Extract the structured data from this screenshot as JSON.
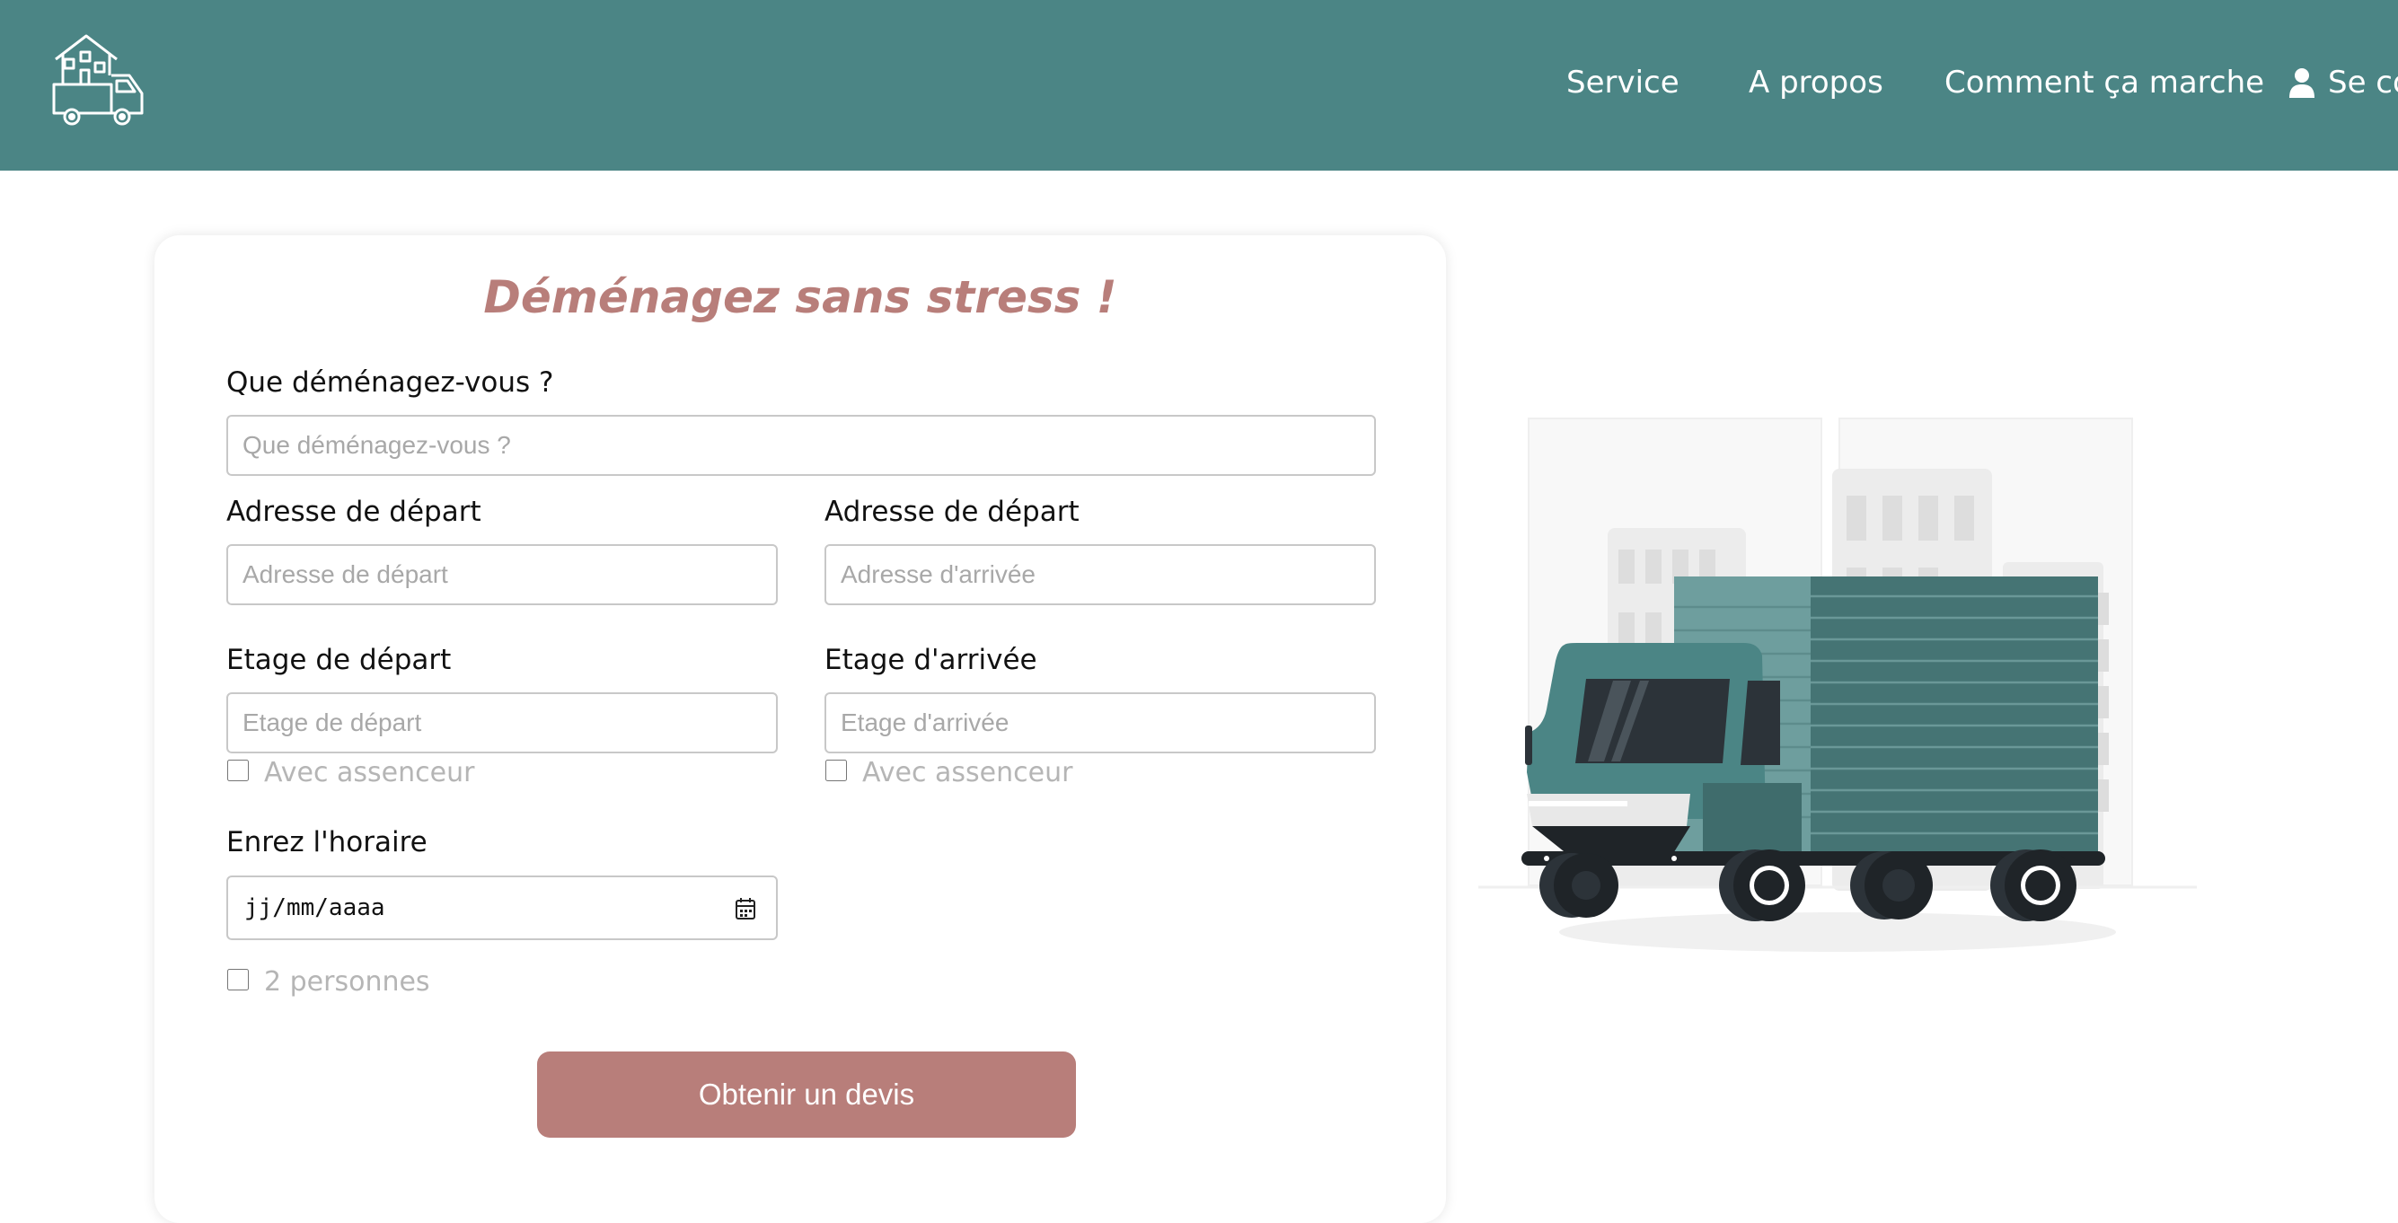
{
  "header": {
    "nav": {
      "service": "Service",
      "about": "A propos",
      "how": "Comment ça marche",
      "login": "Se co"
    },
    "colors": {
      "background": "#4b8585",
      "text": "#ffffff"
    }
  },
  "form": {
    "title": "Déménagez sans stress !",
    "what_label": "Que déménagez-vous ?",
    "what_placeholder": "Que déménagez-vous ?",
    "start_address_label": "Adresse de départ",
    "start_address_placeholder": "Adresse de départ",
    "end_address_label": "Adresse de départ",
    "end_address_placeholder": "Adresse d'arrivée",
    "start_floor_label": "Etage de départ",
    "start_floor_placeholder": "Etage de départ",
    "end_floor_label": "Etage d'arrivée",
    "end_floor_placeholder": "Etage d'arrivée",
    "elevator_label": "Avec assenceur",
    "schedule_label": "Enrez l'horaire",
    "date_value": "jj/mm/aaaa",
    "two_people_label": "2 personnes",
    "submit_label": "Obtenir un devis",
    "colors": {
      "accent": "#b87e7a"
    }
  },
  "icons": {
    "logo": "house-truck-logo-icon",
    "user": "user-icon",
    "calendar": "calendar-icon"
  }
}
